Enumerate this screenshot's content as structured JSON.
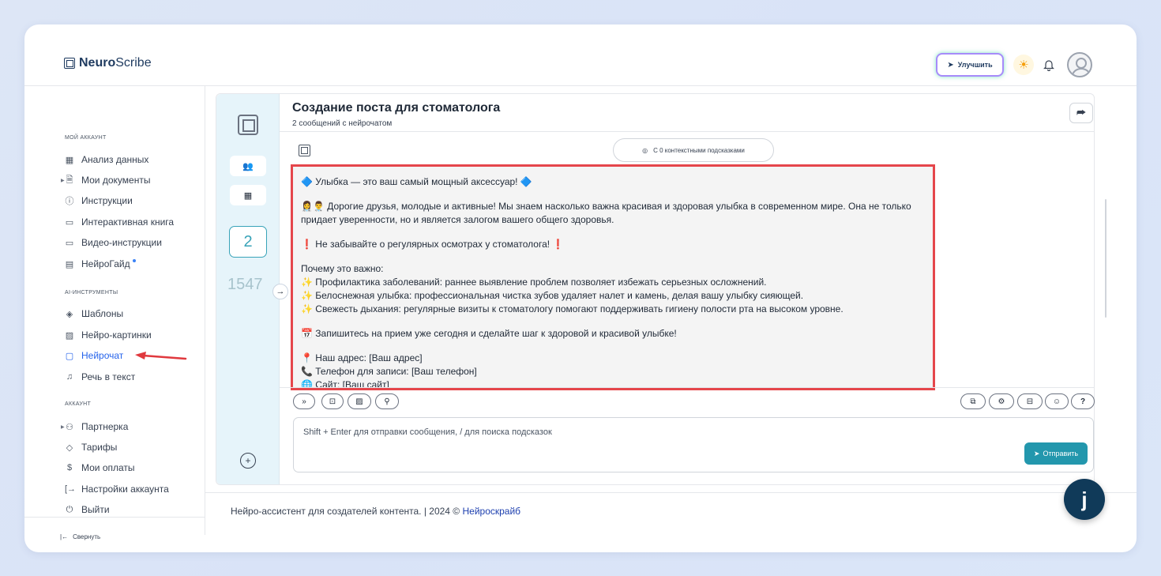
{
  "app": {
    "logo_bold": "Neuro",
    "logo_rest": "Scribe"
  },
  "header": {
    "upgrade_label": "Улучшить"
  },
  "sidebar": {
    "account_section": "МОЙ АККАУНТ",
    "account_items": [
      {
        "label": "Анализ данных",
        "icon": "grid-icon"
      },
      {
        "label": "Мои документы",
        "icon": "document-icon"
      },
      {
        "label": "Инструкции",
        "icon": "help-icon"
      },
      {
        "label": "Интерактивная книга",
        "icon": "book-icon"
      },
      {
        "label": "Видео-инструкции",
        "icon": "video-icon"
      },
      {
        "label": "НейроГайд",
        "icon": "guide-icon"
      }
    ],
    "tools_section": "AI-ИНСТРУМЕНТЫ",
    "tools_items": [
      {
        "label": "Шаблоны",
        "icon": "layers-icon"
      },
      {
        "label": "Нейро-картинки",
        "icon": "image-icon"
      },
      {
        "label": "Нейрочат",
        "icon": "chat-icon"
      },
      {
        "label": "Речь в текст",
        "icon": "headphones-icon"
      }
    ],
    "profile_section": "АККАУНТ",
    "profile_items": [
      {
        "label": "Партнерка",
        "icon": "users-icon"
      },
      {
        "label": "Тарифы",
        "icon": "tag-icon"
      },
      {
        "label": "Мои оплаты",
        "icon": "dollar-icon"
      },
      {
        "label": "Настройки аккаунта",
        "icon": "settings-icon"
      },
      {
        "label": "Выйти",
        "icon": "power-icon"
      }
    ],
    "collapse_label": "Свернуть"
  },
  "chat": {
    "title": "Создание поста для стоматолога",
    "subtitle": "2 сообщений с нейрочатом",
    "rail_count": "2",
    "rail_number": "1547",
    "context_pill": "С 0 контекстными подсказками",
    "message": {
      "p1": "🔷 Улыбка — это ваш самый мощный аксессуар! 🔷",
      "p2": "👩‍⚕️👨‍⚕️ Дорогие друзья, молодые и активные! Мы знаем насколько важна красивая и здоровая улыбка в современном мире. Она не только придает уверенности, но и является залогом вашего общего здоровья.",
      "p3": "❗ Не забывайте о регулярных осмотрах у стоматолога! ❗",
      "p4_head": "Почему это важно:",
      "p4_l1": "✨ Профилактика заболеваний: раннее выявление проблем позволяет избежать серьезных осложнений.",
      "p4_l2": "✨ Белоснежная улыбка: профессиональная чистка зубов удаляет налет и камень, делая вашу улыбку сияющей.",
      "p4_l3": "✨ Свежесть дыхания: регулярные визиты к стоматологу помогают поддерживать гигиену полости рта на высоком уровне.",
      "p5": "📅 Запишитесь на прием уже сегодня и сделайте шаг к здоровой и красивой улыбке!",
      "p6_l1": "📍 Наш адрес: [Ваш адрес]",
      "p6_l2": "📞 Телефон для записи: [Ваш телефон]",
      "p6_l3": "🌐 Сайт: [Ваш сайт]"
    },
    "input_placeholder": "Shift + Enter для отправки сообщения, / для поиска подсказок",
    "send_label": "Отправить",
    "help_label": "?"
  },
  "footer": {
    "text": "Нейро-ассистент для создателей контента.  | 2024 © ",
    "link": "Нейроскрайб"
  },
  "fab": {
    "label": "j"
  }
}
